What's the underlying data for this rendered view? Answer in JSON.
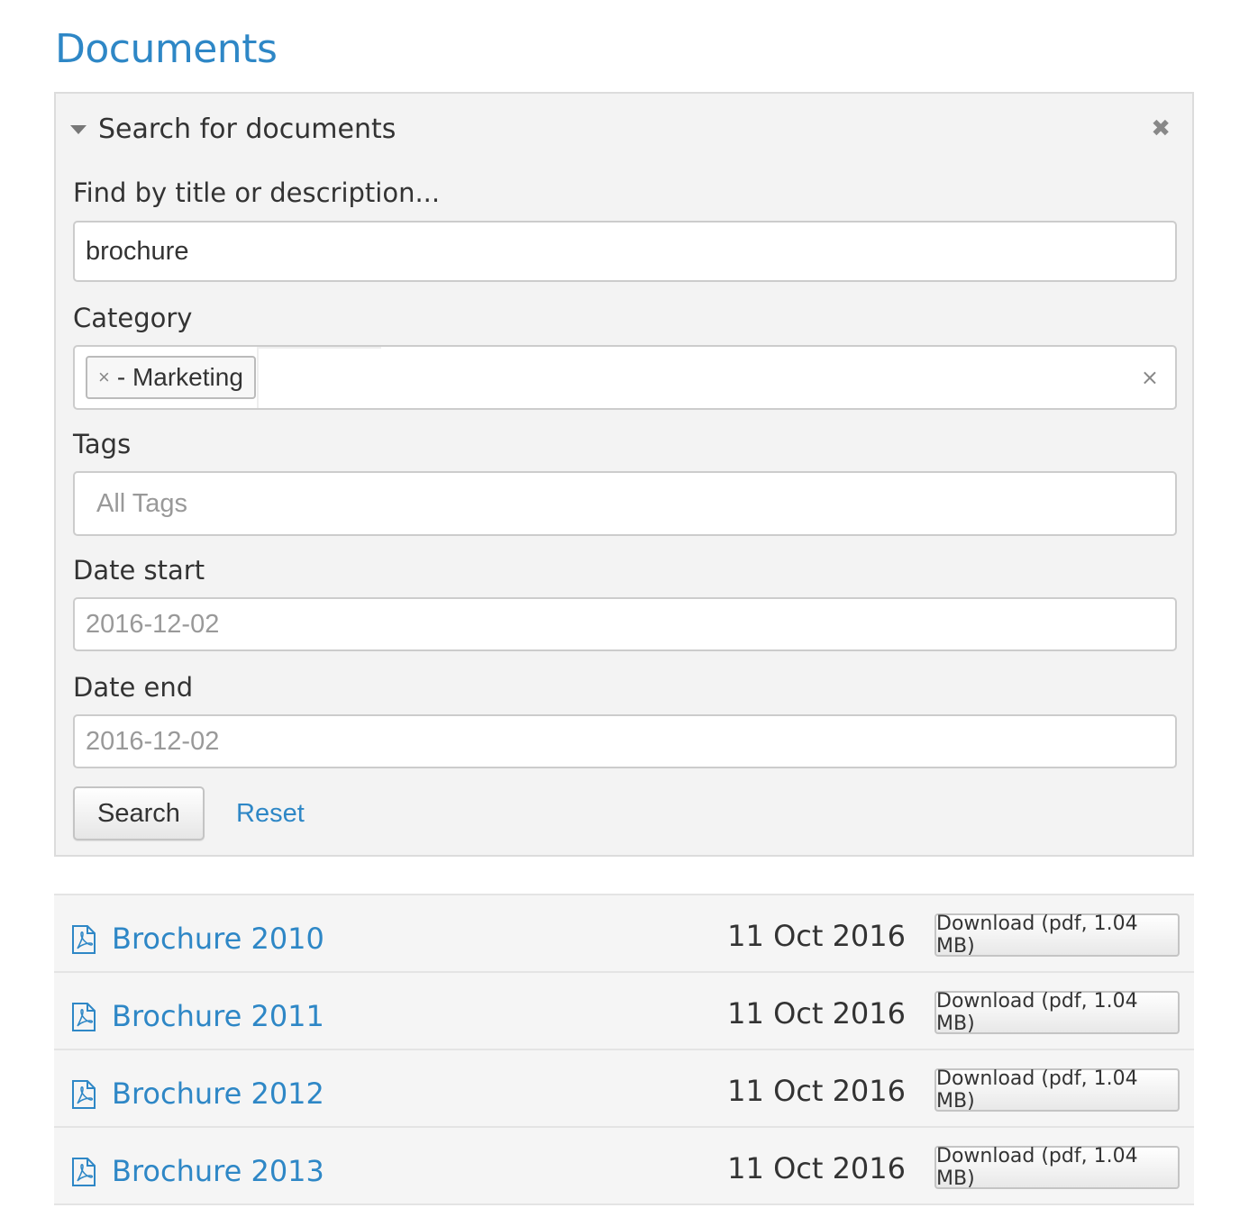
{
  "page": {
    "title": "Documents"
  },
  "search_panel": {
    "title": "Search for documents",
    "close_glyph": "✖",
    "title_field": {
      "label": "Find by title or description...",
      "value": "brochure"
    },
    "category": {
      "label": "Category",
      "selected": [
        {
          "remove_glyph": "×",
          "label": "- Marketing"
        }
      ],
      "clear_glyph": "×"
    },
    "tags": {
      "label": "Tags",
      "placeholder": "All Tags"
    },
    "date_start": {
      "label": "Date start",
      "placeholder": "2016-12-02"
    },
    "date_end": {
      "label": "Date end",
      "placeholder": "2016-12-02"
    },
    "search_button": "Search",
    "reset_link": "Reset"
  },
  "results": [
    {
      "icon": "pdf-icon",
      "title": "Brochure 2010",
      "date": "11 Oct 2016",
      "download": "Download (pdf, 1.04 MB)"
    },
    {
      "icon": "pdf-icon",
      "title": "Brochure 2011",
      "date": "11 Oct 2016",
      "download": "Download (pdf, 1.04 MB)"
    },
    {
      "icon": "pdf-icon",
      "title": "Brochure 2012",
      "date": "11 Oct 2016",
      "download": "Download (pdf, 1.04 MB)"
    },
    {
      "icon": "pdf-icon",
      "title": "Brochure 2013",
      "date": "11 Oct 2016",
      "download": "Download (pdf, 1.04 MB)"
    }
  ],
  "colors": {
    "accent": "#2e87c6",
    "panel_bg": "#f3f3f3",
    "row_bg": "#f5f5f5"
  }
}
